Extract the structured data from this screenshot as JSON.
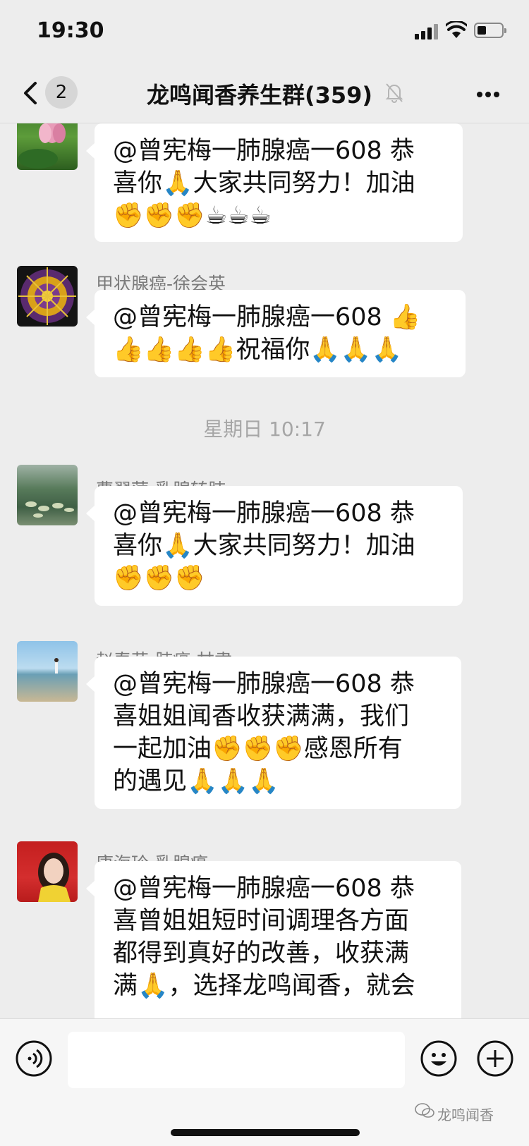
{
  "status_bar": {
    "time": "19:30"
  },
  "nav": {
    "back_badge": "2",
    "title": "龙鸣闻香养生群(359)"
  },
  "messages": [
    {
      "sender": "",
      "avatar": "lotus-avatar",
      "lines": [
        "@曾宪梅一肺腺癌一608 恭",
        "喜你🙏大家共同努力！加油",
        "✊✊✊☕☕☕"
      ]
    },
    {
      "sender": "甲状腺癌-徐会英",
      "avatar": "mandala-avatar",
      "lines": [
        "@曾宪梅一肺腺癌一608 👍",
        "👍👍👍👍祝福你🙏🙏🙏"
      ]
    },
    {
      "sender": "曹翠萍-乳腺转肺",
      "avatar": "pond-avatar",
      "lines": [
        "@曾宪梅一肺腺癌一608 恭",
        "喜你🙏大家共同努力！加油",
        "✊✊✊"
      ]
    },
    {
      "sender": "赵春花-肺癌-甘肃",
      "avatar": "beach-avatar",
      "lines": [
        "@曾宪梅一肺腺癌一608 恭",
        "喜姐姐闻香收获满满，我们",
        "一起加油✊✊✊感恩所有",
        "的遇见🙏🙏🙏"
      ]
    },
    {
      "sender": "康海玲-乳腺癌",
      "avatar": "woman-avatar",
      "lines": [
        "@曾宪梅一肺腺癌一608 恭",
        "喜曾姐姐短时间调理各方面",
        "都得到真好的改善，收获满",
        "满🙏，选择龙鸣闻香，就会"
      ]
    }
  ],
  "timestamp": "星期日 10:17",
  "watermark": "龙鸣闻香"
}
